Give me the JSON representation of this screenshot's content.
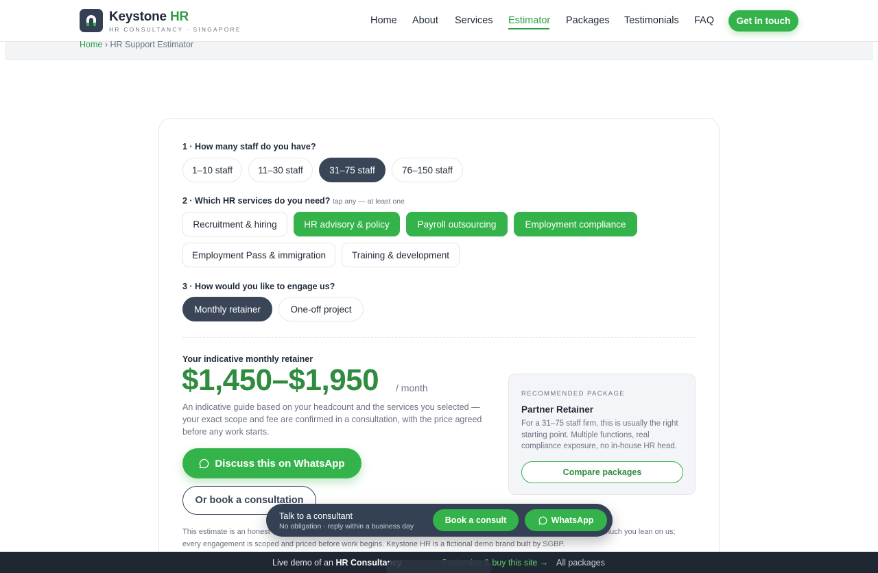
{
  "brand": {
    "name_main": "Keystone",
    "name_accent": "HR",
    "tagline": "HR CONSULTANCY · SINGAPORE",
    "colors": {
      "accent": "#34b34a",
      "dark": "#3a4558"
    }
  },
  "nav": {
    "items": [
      "Home",
      "About",
      "Services",
      "Estimator",
      "Packages",
      "Testimonials",
      "FAQ"
    ],
    "active": "Estimator",
    "cta": "Get in touch"
  },
  "breadcrumb": {
    "home": "Home",
    "separator": "›",
    "current": "HR Support Estimator"
  },
  "estimator": {
    "q1": {
      "label": "1 · How many staff do you have?",
      "options": [
        "1–10 staff",
        "11–30 staff",
        "31–75 staff",
        "76–150 staff"
      ],
      "selected": "31–75 staff"
    },
    "q2": {
      "label": "2 · Which HR services do you need?",
      "hint": "tap any — at least one",
      "options": [
        "Recruitment & hiring",
        "HR advisory & policy",
        "Payroll outsourcing",
        "Employment compliance",
        "Employment Pass & immigration",
        "Training & development"
      ],
      "selected": [
        "HR advisory & policy",
        "Payroll outsourcing",
        "Employment compliance"
      ]
    },
    "q3": {
      "label": "3 · How would you like to engage us?",
      "options": [
        "Monthly retainer",
        "One-off project"
      ],
      "selected": "Monthly retainer"
    },
    "result": {
      "label": "Your indicative monthly retainer",
      "price": "$1,450–$1,950",
      "period": "/ month",
      "description": "An indicative guide based on your headcount and the services you selected — your exact scope and fee are confirmed in a consultation, with the price agreed before any work starts.",
      "whatsapp_button": "Discuss this on WhatsApp",
      "book_button": "Or book a consultation",
      "disclaimer_start": "This estimate is an honest",
      "disclaimer_end": "much you lean on us;",
      "disclaimer_line2": "every engagement is scoped and priced before work begins. Keystone HR is a fictional demo brand built by SGBP."
    },
    "recommended": {
      "kicker": "RECOMMENDED PACKAGE",
      "title": "Partner Retainer",
      "text": "For a 31–75 staff firm, this is usually the right starting point. Multiple functions, real compliance exposure, no in-house HR head.",
      "button": "Compare packages"
    }
  },
  "float_bar": {
    "title": "Talk to a consultant",
    "subtitle": "No obligation · reply within a business day",
    "book": "Book a consult",
    "whatsapp": "WhatsApp"
  },
  "demo_strip": {
    "prefix": "Live demo of an",
    "bold": "HR Consultancy",
    "link": "Customise & buy this site →",
    "all": "All packages"
  }
}
